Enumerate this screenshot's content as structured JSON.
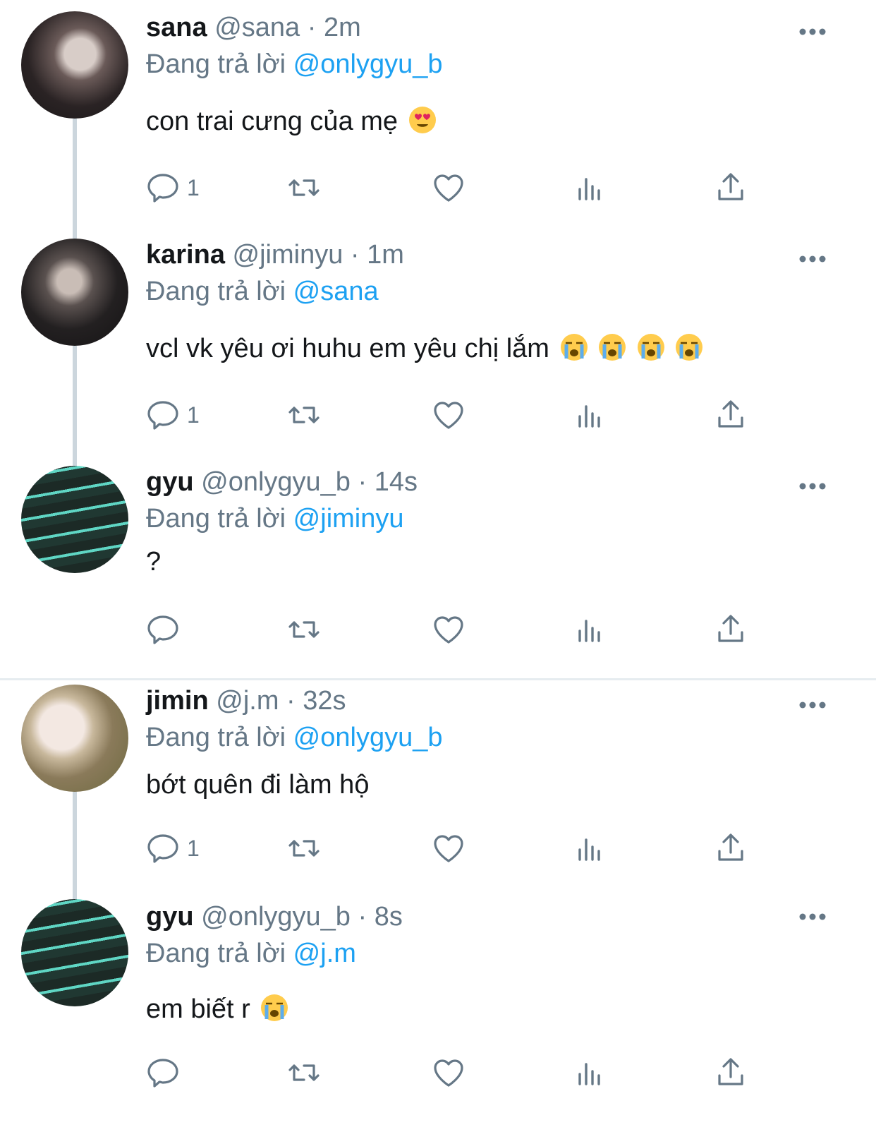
{
  "reply_prefix": "Đang trả lời",
  "colors": {
    "mention": "#1da1f2",
    "meta": "#657786",
    "line": "#ccd6dd"
  },
  "tweets": [
    {
      "name": "sana",
      "handle": "@sana",
      "time": "2m",
      "reply_to": "@onlygyu_b",
      "text": "con trai cưng của mẹ",
      "emojis": [
        "heart-eyes-emoji"
      ],
      "replies": "1"
    },
    {
      "name": "karina",
      "handle": "@jiminyu",
      "time": "1m",
      "reply_to": "@sana",
      "text": "vcl vk yêu ơi huhu em yêu chị lắm",
      "emojis": [
        "loudly-crying-emoji",
        "loudly-crying-emoji",
        "loudly-crying-emoji",
        "loudly-crying-emoji"
      ],
      "replies": "1"
    },
    {
      "name": "gyu",
      "handle": "@onlygyu_b",
      "time": "14s",
      "reply_to": "@jiminyu",
      "text": "?",
      "emojis": [],
      "replies": ""
    },
    {
      "name": "jimin",
      "handle": "@j.m",
      "time": "32s",
      "reply_to": "@onlygyu_b",
      "text": "bớt quên đi làm hộ",
      "emojis": [],
      "replies": "1"
    },
    {
      "name": "gyu",
      "handle": "@onlygyu_b",
      "time": "8s",
      "reply_to": "@j.m",
      "text": "em biết r",
      "emojis": [
        "loudly-crying-emoji"
      ],
      "replies": ""
    }
  ]
}
